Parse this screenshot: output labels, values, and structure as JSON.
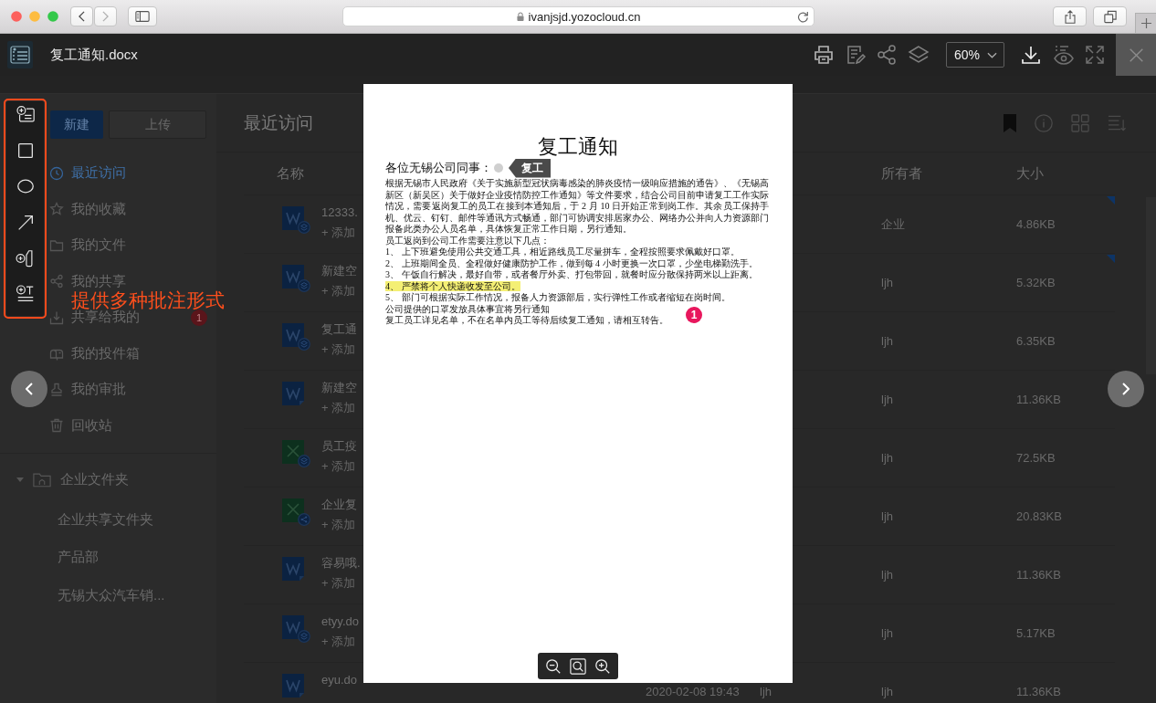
{
  "browser": {
    "url": "ivanjsjd.yozocloud.cn"
  },
  "viewer": {
    "file_name": "复工通知.docx",
    "zoom": "60%"
  },
  "sidebar": {
    "buttons": [
      {
        "label": "新建",
        "kind": "primary"
      },
      {
        "label": "上传",
        "kind": "secondary"
      }
    ],
    "items": [
      {
        "label": "最近访问",
        "selected": true
      },
      {
        "label": "我的收藏",
        "selected": false
      },
      {
        "label": "我的文件",
        "selected": false
      },
      {
        "label": "我的共享",
        "selected": false
      },
      {
        "label": "共享给我的",
        "selected": false,
        "badge": "1"
      },
      {
        "label": "我的投件箱",
        "selected": false
      },
      {
        "label": "我的审批",
        "selected": false
      },
      {
        "label": "回收站",
        "selected": false
      }
    ],
    "folders": [
      {
        "label": "企业文件夹",
        "expanded": true,
        "children": [
          {
            "label": "企业共享文件夹"
          },
          {
            "label": "产品部"
          },
          {
            "label": "无锡大众汽车销..."
          }
        ]
      }
    ]
  },
  "main": {
    "title": "最近访问",
    "table": {
      "columns": [
        "名称",
        "所有者",
        "大小"
      ],
      "rows": [
        {
          "kind": "doc",
          "name": "12333.",
          "tag_hint": "+ 添加",
          "owner": "企业",
          "size": "4.86KB",
          "layers_badge": true,
          "share_badge": false,
          "corner_mark": true
        },
        {
          "kind": "doc",
          "name": "新建空",
          "tag_hint": "+ 添加",
          "owner": "ljh",
          "size": "5.32KB",
          "layers_badge": true,
          "share_badge": false,
          "corner_mark": true
        },
        {
          "kind": "doc",
          "name": "复工通",
          "tag_hint": "+ 添加",
          "owner": "ljh",
          "size": "6.35KB",
          "layers_badge": true,
          "share_badge": false,
          "corner_mark": false
        },
        {
          "kind": "doc",
          "name": "新建空",
          "tag_hint": "+ 添加",
          "owner": "ljh",
          "size": "11.36KB",
          "layers_badge": false,
          "share_badge": false,
          "corner_mark": false
        },
        {
          "kind": "sheet",
          "name": "员工疫",
          "tag_hint": "+ 添加",
          "owner": "ljh",
          "size": "72.5KB",
          "layers_badge": true,
          "share_badge": false,
          "corner_mark": false
        },
        {
          "kind": "sheet",
          "name": "企业复",
          "tag_hint": "+ 添加",
          "owner": "ljh",
          "size": "20.83KB",
          "layers_badge": false,
          "share_badge": true,
          "corner_mark": false
        },
        {
          "kind": "doc",
          "name": "容易哦.",
          "tag_hint": "+ 添加",
          "owner": "ljh",
          "size": "11.36KB",
          "layers_badge": false,
          "share_badge": false,
          "corner_mark": false
        },
        {
          "kind": "doc",
          "name": "etyy.do",
          "tag_hint": "+ 添加",
          "owner": "ljh",
          "size": "5.17KB",
          "layers_badge": true,
          "share_badge": false,
          "corner_mark": false
        },
        {
          "kind": "doc",
          "name": "eyu.do",
          "column_3": "2020-02-08 19:43",
          "column_4": "ljh",
          "owner": "ljh",
          "size": "11.36KB",
          "layers_badge": false,
          "share_badge": false,
          "corner_mark": false
        }
      ]
    }
  },
  "document": {
    "title": "复工通知",
    "greeting": "各位无锡公司同事：",
    "comment_tag": "复工",
    "body": [
      {
        "text": "根据无锡市人民政府《关于实施新型冠状病毒感染的肺炎疫情一级响应措施的通告》、《无锡高新区（新吴区）关于做好企业疫情防控工作通知》等文件要求，结合公司目前申请复工工作实际情况，需要返岗复工的员工在接到本通知后，于 2 月 10 日开始正常到岗工作。其余员工保持手机、优云、钉钉、邮件等通讯方式畅通，部门可协调安排居家办公、网络办公并向人力资源部门报备此类办公人员名单，具体恢复正常工作日期，另行通知。",
        "highlighted": false
      },
      {
        "text": "员工返岗到公司工作需要注意以下几点：",
        "highlighted": false
      },
      {
        "text": "1、 上下班避免使用公共交通工具，相近路线员工尽量拼车，全程按照要求佩戴好口罩。",
        "highlighted": false
      },
      {
        "text": "2、 上班期间全员、全程做好健康防护工作，做到每 4 小时更换一次口罩，少坐电梯勤洗手。",
        "highlighted": false
      },
      {
        "text": "3、 午饭自行解决，最好自带，或者餐厅外卖、打包带回，就餐时应分散保持两米以上距离。",
        "highlighted": false
      },
      {
        "text": "4、 严禁将个人快递收发至公司。",
        "highlighted": true
      },
      {
        "text": "5、 部门可根据实际工作情况，报备人力资源部后，实行弹性工作或者缩短在岗时间。",
        "highlighted": false
      },
      {
        "text": "公司提供的口罩发放具体事宜将另行通知",
        "highlighted": false,
        "marker": "1"
      },
      {
        "text": "复工员工详见名单，不在名单内员工等待后续复工通知，请相互转告。",
        "highlighted": false
      }
    ]
  },
  "caption": "提供多种批注形式"
}
